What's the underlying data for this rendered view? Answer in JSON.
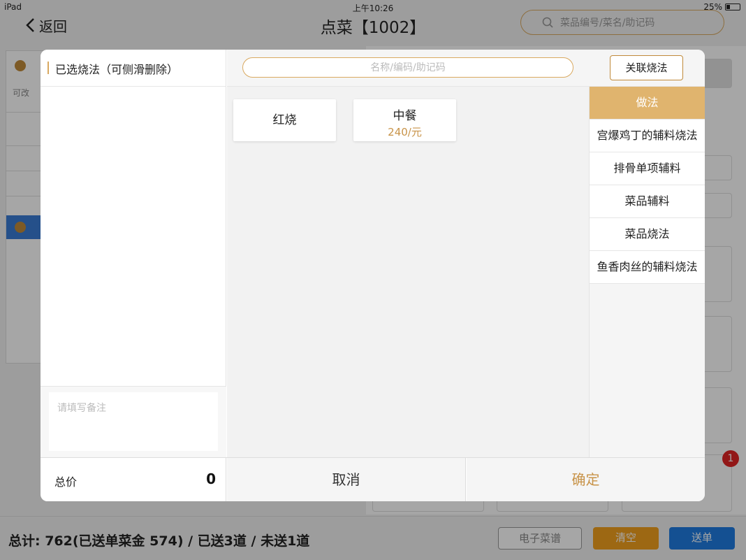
{
  "statusbar": {
    "device": "iPad",
    "time": "上午10:26",
    "battery": "25%"
  },
  "nav": {
    "back_label": "返回",
    "title": "点菜【1002】",
    "search_placeholder": "菜品编号/菜名/助记码"
  },
  "background": {
    "tag_text": "可改",
    "badge_count": "1"
  },
  "bottombar": {
    "total_text": "总计: 762(已送单菜金 574) / 已送3道 / 未送1道",
    "menu_button": "电子菜谱",
    "clear_button": "清空",
    "send_button": "送单"
  },
  "modal": {
    "left_title": "已选烧法（可侧滑删除）",
    "note_placeholder": "请填写备注",
    "search_placeholder": "名称/编码/助记码",
    "link_button": "关联烧法",
    "methods": [
      {
        "name": "红烧",
        "price": ""
      },
      {
        "name": "中餐",
        "price": "240/元"
      }
    ],
    "categories": [
      {
        "label": "做法",
        "active": true
      },
      {
        "label": "宫爆鸡丁的辅料烧法",
        "active": false
      },
      {
        "label": "排骨单项辅料",
        "active": false
      },
      {
        "label": "菜品辅料",
        "active": false
      },
      {
        "label": "菜品烧法",
        "active": false
      },
      {
        "label": "鱼香肉丝的辅料烧法",
        "active": false
      }
    ],
    "total_label": "总价",
    "total_value": "0",
    "cancel_button": "取消",
    "confirm_button": "确定"
  },
  "colors": {
    "accent": "#d9a960",
    "active_category": "#e0b46e",
    "price": "#c89348",
    "clear": "#f2a01e",
    "send": "#1f7be0"
  }
}
